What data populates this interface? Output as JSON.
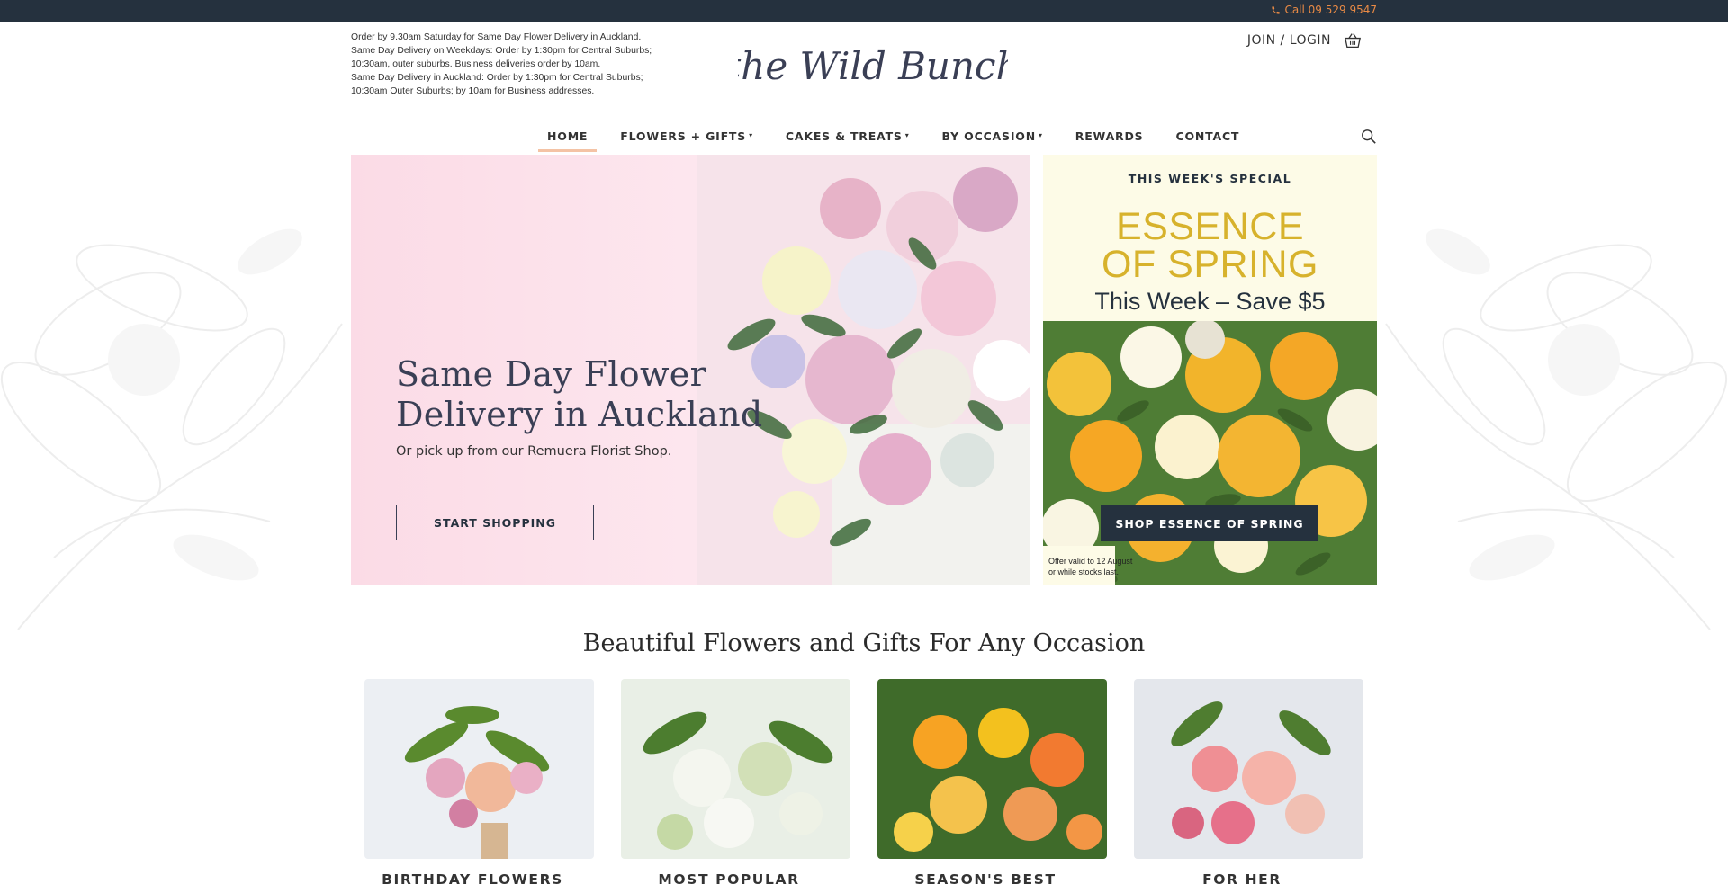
{
  "topbar": {
    "call_label": "Call 09 529 9547",
    "accent": "#e98a45"
  },
  "delivery_info": [
    "Order by 9.30am Saturday for Same Day Flower Delivery in Auckland.",
    "Same Day Delivery on Weekdays: Order by 1:30pm for Central Suburbs;",
    "10:30am, outer suburbs. Business deliveries order by 10am.",
    "Same Day Delivery in Auckland: Order by 1:30pm for Central Suburbs;",
    "10:30am Outer Suburbs; by 10am for Business addresses."
  ],
  "logo": {
    "text": "the Wild Bunch"
  },
  "account": {
    "login_label": "JOIN / LOGIN",
    "cart_icon": "basket-icon"
  },
  "nav": {
    "items": [
      {
        "label": "HOME",
        "active": true,
        "dropdown": false
      },
      {
        "label": "FLOWERS + GIFTS",
        "active": false,
        "dropdown": true
      },
      {
        "label": "CAKES & TREATS",
        "active": false,
        "dropdown": true
      },
      {
        "label": "BY OCCASION",
        "active": false,
        "dropdown": true
      },
      {
        "label": "REWARDS",
        "active": false,
        "dropdown": false
      },
      {
        "label": "CONTACT",
        "active": false,
        "dropdown": false
      }
    ],
    "search_icon": "search-icon"
  },
  "hero": {
    "title_line1": "Same Day Flower",
    "title_line2": "Delivery in Auckland",
    "subtitle": "Or pick up from our Remuera Florist Shop.",
    "cta": "START SHOPPING"
  },
  "special": {
    "label": "THIS WEEK'S SPECIAL",
    "title_line1": "ESSENCE",
    "title_line2": "OF SPRING",
    "saving": "This Week – Save $5",
    "cta": "SHOP ESSENCE OF SPRING",
    "offer_line1": "Offer valid  to 12 August",
    "offer_line2": "or while stocks last."
  },
  "section": {
    "title": "Beautiful Flowers and Gifts For Any Occasion"
  },
  "categories": [
    {
      "name": "BIRTHDAY FLOWERS"
    },
    {
      "name": "MOST POPULAR"
    },
    {
      "name": "SEASON'S BEST"
    },
    {
      "name": "FOR HER"
    }
  ],
  "colors": {
    "navy": "#25313e",
    "hero_pink": "#fbdbe6",
    "special_bg": "#fdfbe7",
    "special_gold": "#d7b22c",
    "nav_underline": "#f4c3a5"
  }
}
